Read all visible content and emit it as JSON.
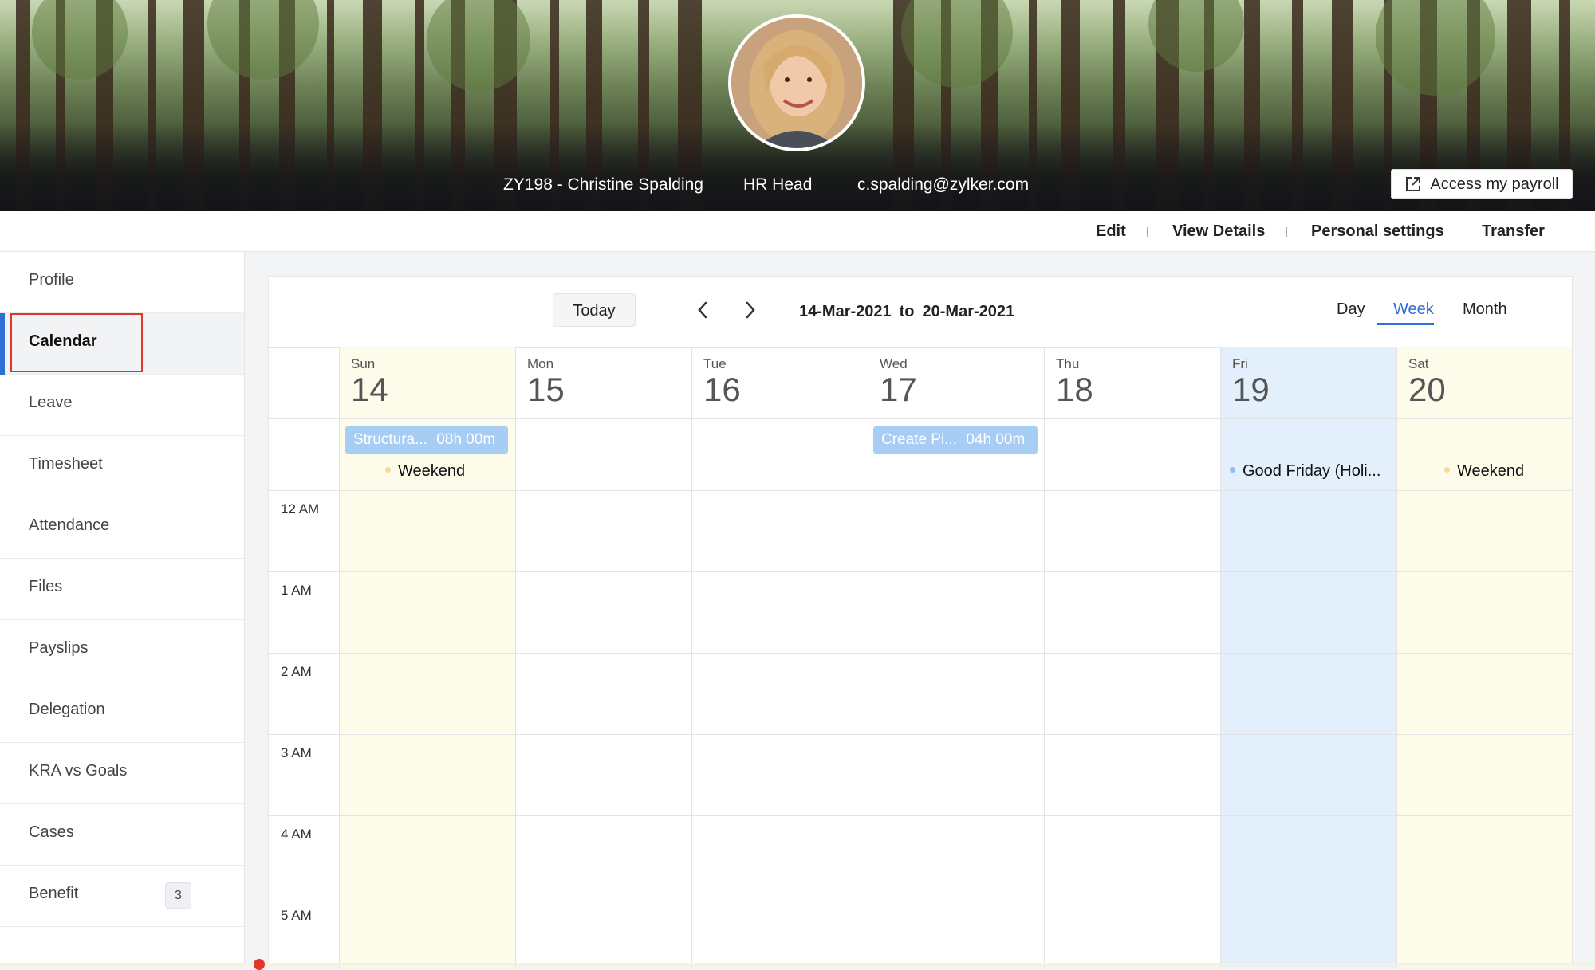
{
  "banner": {
    "employee": "ZY198 - Christine Spalding",
    "role": "HR Head",
    "email": "c.spalding@zylker.com",
    "payroll_button": "Access my payroll",
    "payroll_icon": "external-link-icon"
  },
  "actions": [
    "Edit",
    "View Details",
    "Personal settings",
    "Transfer"
  ],
  "sidebar": {
    "items": [
      {
        "label": "Profile"
      },
      {
        "label": "Calendar",
        "active": true
      },
      {
        "label": "Leave"
      },
      {
        "label": "Timesheet"
      },
      {
        "label": "Attendance"
      },
      {
        "label": "Files"
      },
      {
        "label": "Payslips"
      },
      {
        "label": "Delegation"
      },
      {
        "label": "KRA vs Goals"
      },
      {
        "label": "Cases"
      },
      {
        "label": "Benefit",
        "badge": "3"
      }
    ]
  },
  "calendar": {
    "today_label": "Today",
    "range_from": "14-Mar-2021",
    "range_to_word": "to",
    "range_to": "20-Mar-2021",
    "views": [
      "Day",
      "Week",
      "Month"
    ],
    "active_view": "Week",
    "days": [
      {
        "abbr": "Sun",
        "num": "14",
        "kind": "weekend"
      },
      {
        "abbr": "Mon",
        "num": "15",
        "kind": "normal"
      },
      {
        "abbr": "Tue",
        "num": "16",
        "kind": "normal"
      },
      {
        "abbr": "Wed",
        "num": "17",
        "kind": "normal"
      },
      {
        "abbr": "Thu",
        "num": "18",
        "kind": "normal"
      },
      {
        "abbr": "Fri",
        "num": "19",
        "kind": "holiday"
      },
      {
        "abbr": "Sat",
        "num": "20",
        "kind": "weekend"
      }
    ],
    "events": [
      {
        "day": "Sun",
        "title": "Structura...",
        "duration": "08h 00m"
      },
      {
        "day": "Wed",
        "title": "Create Pi...",
        "duration": "04h 00m"
      }
    ],
    "tags": [
      {
        "day": "Sun",
        "label": "Weekend",
        "dot_color": "#f3df8a"
      },
      {
        "day": "Fri",
        "label": "Good Friday (Holi...",
        "dot_color": "#8dbfee"
      },
      {
        "day": "Sat",
        "label": "Weekend",
        "dot_color": "#f3df8a"
      }
    ],
    "hours": [
      "12 AM",
      "1 AM",
      "2 AM",
      "3 AM",
      "4 AM",
      "5 AM"
    ],
    "colors": {
      "weekend": "#fdfbea",
      "holiday": "#e3effb",
      "event": "#a7cdf4",
      "accent": "#2f6fd6"
    }
  }
}
